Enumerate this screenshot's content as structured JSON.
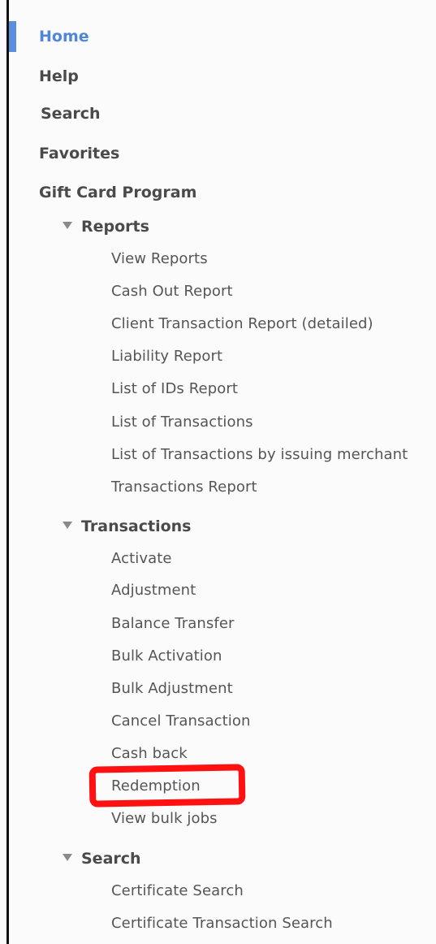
{
  "nav": {
    "top_items": [
      "Home",
      "Help",
      "Search",
      "Favorites",
      "Gift Card Program"
    ],
    "reports": {
      "label": "Reports",
      "items": [
        "View Reports",
        "Cash Out Report",
        "Client Transaction Report (detailed)",
        "Liability Report",
        "List of IDs Report",
        "List of Transactions",
        "List of Transactions by issuing merchant",
        "Transactions Report"
      ]
    },
    "transactions": {
      "label": "Transactions",
      "items": [
        "Activate",
        "Adjustment",
        "Balance Transfer",
        "Bulk Activation",
        "Bulk Adjustment",
        "Cancel Transaction",
        "Cash back",
        "Redemption",
        "View bulk jobs"
      ]
    },
    "search_section": {
      "label": "Search",
      "items": [
        "Certificate Search",
        "Certificate Transaction Search"
      ]
    }
  },
  "colors": {
    "active": "#4f86d8",
    "highlight": "#ff1111"
  },
  "icons": {
    "section_toggle": "triangle-down-icon"
  }
}
